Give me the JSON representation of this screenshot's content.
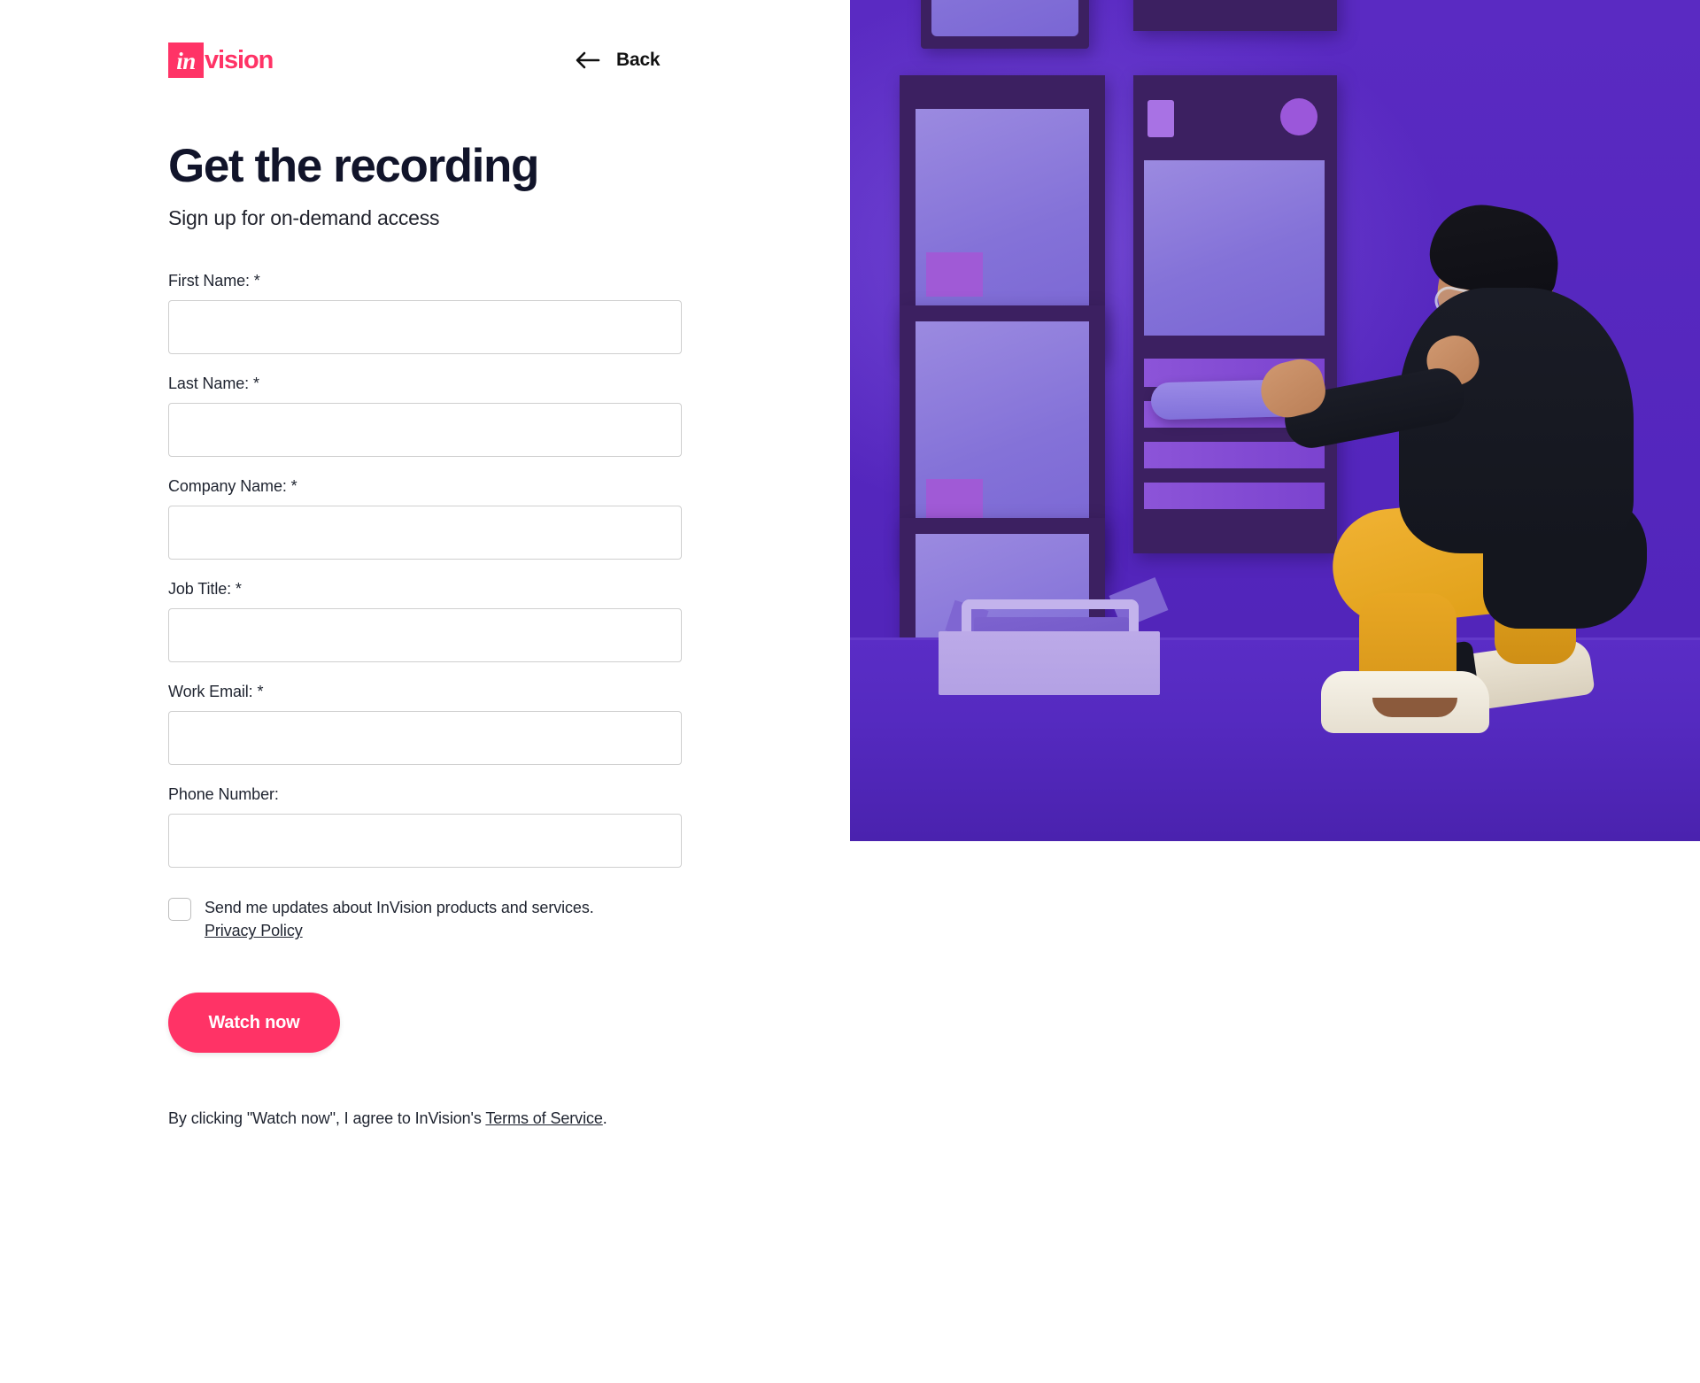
{
  "brand": {
    "logo_mark_text": "in",
    "logo_word_text": "vision",
    "accent_color": "#FF3366",
    "logo_icon": "invision-logo-icon"
  },
  "header": {
    "back_label": "Back",
    "back_icon": "arrow-left-icon"
  },
  "hero": {
    "title": "Get the recording",
    "subtitle": "Sign up for on-demand access"
  },
  "form": {
    "fields": [
      {
        "label": "First Name: *",
        "name": "first-name",
        "value": "",
        "placeholder": "",
        "required": true,
        "type": "text"
      },
      {
        "label": "Last Name: *",
        "name": "last-name",
        "value": "",
        "placeholder": "",
        "required": true,
        "type": "text"
      },
      {
        "label": "Company Name: *",
        "name": "company-name",
        "value": "",
        "placeholder": "",
        "required": true,
        "type": "text"
      },
      {
        "label": "Job Title: *",
        "name": "job-title",
        "value": "",
        "placeholder": "",
        "required": true,
        "type": "text"
      },
      {
        "label": "Work Email: *",
        "name": "work-email",
        "value": "",
        "placeholder": "",
        "required": true,
        "type": "email"
      },
      {
        "label": "Phone Number:",
        "name": "phone-number",
        "value": "",
        "placeholder": "",
        "required": false,
        "type": "tel"
      }
    ],
    "consent": {
      "checked": false,
      "text": "Send me updates about InVision products and services.",
      "link_label": "Privacy Policy"
    },
    "submit_label": "Watch now",
    "legal": {
      "prefix": "By clicking \"Watch now\", I agree to InVision's ",
      "link_label": "Terms of Service",
      "suffix": "."
    }
  },
  "image": {
    "alt": "Person in black sweater and yellow pants crouching by a purple wall arranging wireframe panels, with a lavender toolbox on the floor",
    "background_color": "#5426bd"
  }
}
